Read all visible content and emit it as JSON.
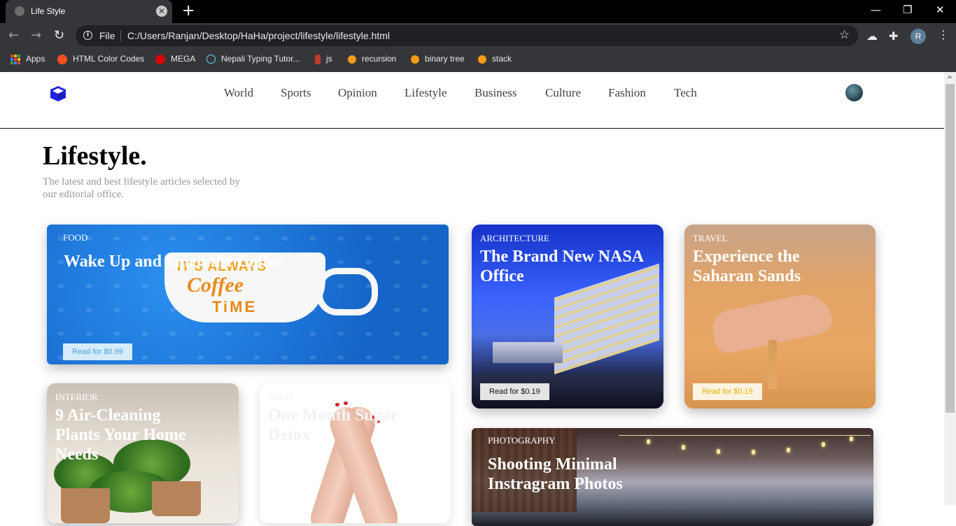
{
  "browser": {
    "tab_title": "Life Style",
    "tab_close_icon": "close-icon",
    "new_tab_icon": "plus-icon",
    "window_controls": [
      "minimize-icon",
      "restore-icon",
      "close-icon"
    ],
    "address": {
      "scheme_label": "File",
      "url": "C:/Users/Ranjan/Desktop/HaHa/project/lifestyle/lifestyle.html"
    },
    "profile_initial": "R",
    "bookmarks": [
      {
        "label": "Apps",
        "icon": "apps-grid-icon",
        "color": "#e8eaed"
      },
      {
        "label": "HTML Color Codes",
        "icon": "html-color-codes-icon",
        "color": "#f4511e"
      },
      {
        "label": "MEGA",
        "icon": "mega-icon",
        "color": "#d90007"
      },
      {
        "label": "Nepali Typing Tutor...",
        "icon": "react-icon",
        "color": "#61dafb"
      },
      {
        "label": "js",
        "icon": "js-icon",
        "color": "#c0392b"
      },
      {
        "label": "recursion",
        "icon": "geeks-icon",
        "color": "#f39c12"
      },
      {
        "label": "binary tree",
        "icon": "geeks-icon",
        "color": "#f39c12"
      },
      {
        "label": "stack",
        "icon": "geeks-icon",
        "color": "#f39c12"
      }
    ]
  },
  "site": {
    "logo_icon": "cube-icon",
    "nav": [
      "World",
      "Sports",
      "Opinion",
      "Lifestyle",
      "Business",
      "Culture",
      "Fashion",
      "Tech"
    ],
    "avatar_icon": "user-avatar"
  },
  "page": {
    "title": "Lifestyle.",
    "subtitle": "The latest and best lifestyle articles selected by our editorial office."
  },
  "cards": [
    {
      "category": "Food",
      "title": "Wake Up and Smell the Coffee",
      "read_label": "Read for $0.99",
      "mug_text": [
        "IT'S ALWAYS",
        "Coffee",
        "TiME"
      ]
    },
    {
      "category": "Architecture",
      "title": "The Brand New NASA Office",
      "read_label": "Read for $0.19"
    },
    {
      "category": "Travel",
      "title": "Experience the Saharan Sands",
      "read_label": "Read for $0.19"
    },
    {
      "category": "Interior",
      "title": "9 Air-Cleaning Plants Your Home Needs"
    },
    {
      "category": "Food",
      "title": "One Month Sugar Detox"
    },
    {
      "category": "Photography",
      "title": "Shooting Minimal Instragram Photos"
    }
  ],
  "colors": {
    "accent_logo": "#1f22e0",
    "read_btn_blue_text": "#4a9fe0",
    "read_btn_gold_text": "#f0b400"
  }
}
